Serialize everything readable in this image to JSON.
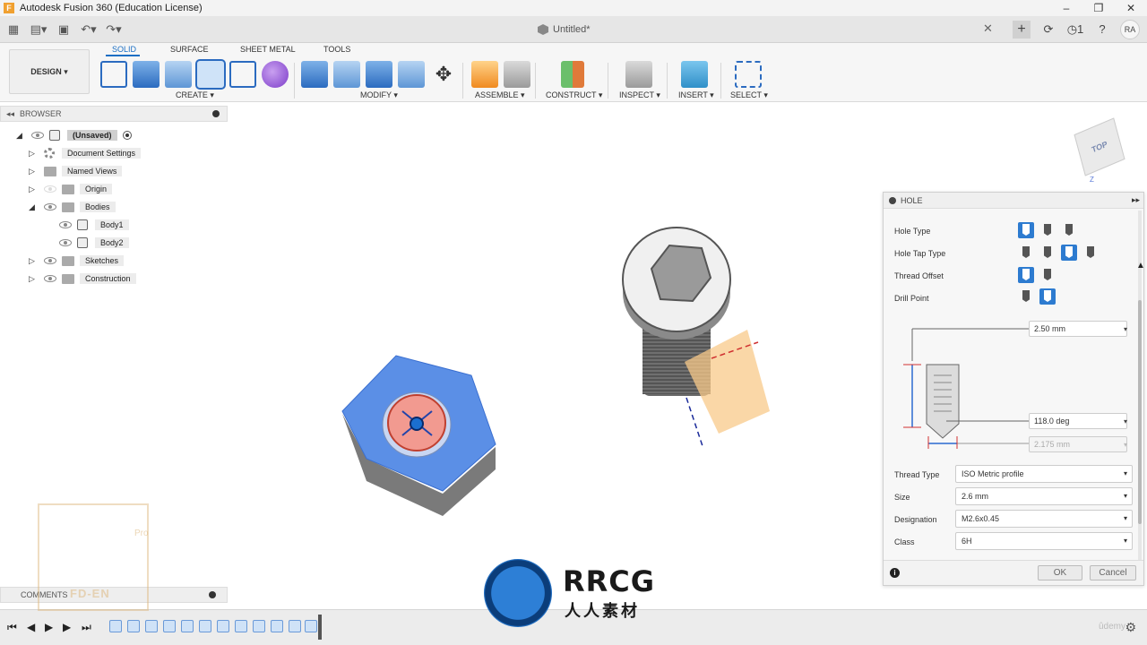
{
  "window": {
    "title": "Autodesk Fusion 360 (Education License)",
    "app_logo": "F",
    "controls": [
      "–",
      "❐",
      "✕"
    ]
  },
  "tabbar": {
    "doc_title": "Untitled*",
    "close": "✕",
    "plus": "+",
    "job_count": "1",
    "user_initials": "RA"
  },
  "ribbon": {
    "workspace": "DESIGN ▾",
    "tabs": [
      "SOLID",
      "SURFACE",
      "SHEET METAL",
      "TOOLS"
    ],
    "groups": [
      "CREATE ▾",
      "MODIFY ▾",
      "ASSEMBLE ▾",
      "CONSTRUCT ▾",
      "INSPECT ▾",
      "INSERT ▾",
      "SELECT ▾"
    ]
  },
  "browser": {
    "title": "BROWSER",
    "root": "(Unsaved)",
    "items": [
      "Document Settings",
      "Named Views",
      "Origin",
      "Bodies",
      "Body1",
      "Body2",
      "Sketches",
      "Construction"
    ]
  },
  "comments": {
    "title": "COMMENTS"
  },
  "viewcube": {
    "face": "TOP",
    "axis": "Z"
  },
  "hole": {
    "title": "HOLE",
    "labels": [
      "Hole Type",
      "Hole Tap Type",
      "Thread Offset",
      "Drill Point"
    ],
    "diameter": "2.50 mm",
    "angle": "118.0 deg",
    "tip_diameter": "2.175 mm",
    "thread_type_label": "Thread Type",
    "thread_type": "ISO Metric profile",
    "size_label": "Size",
    "size": "2.6 mm",
    "designation_label": "Designation",
    "designation": "M2.6x0.45",
    "class_label": "Class",
    "class": "6H",
    "ok": "OK",
    "cancel": "Cancel"
  },
  "watermarks": {
    "brand_big": "RRCG",
    "brand_small": "人人素材",
    "corner_text": "FD-EN",
    "corner_pro": "Pro",
    "udemy": "ûdemy"
  },
  "colors": {
    "accent": "#2b6bc0",
    "face_blue": "#5b8fe6",
    "thread_red": "#e06050",
    "plane_orange": "#f8c98a"
  },
  "icons": [
    "grid-icon",
    "file-icon",
    "save-icon",
    "undo-icon",
    "redo-icon",
    "cube-icon",
    "refresh-icon",
    "clock-icon",
    "help-icon",
    "eye-icon",
    "folder-icon",
    "gear-icon",
    "info-icon",
    "play-icon"
  ]
}
